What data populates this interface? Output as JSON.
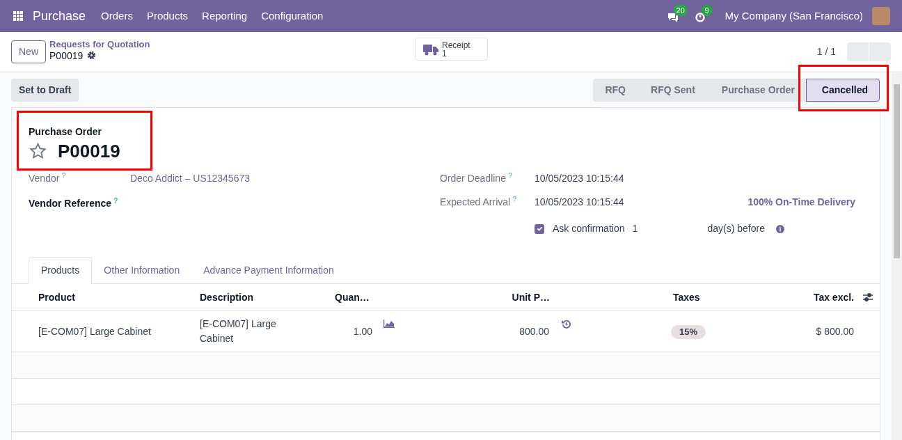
{
  "navbar": {
    "app": "Purchase",
    "menu": [
      "Orders",
      "Products",
      "Reporting",
      "Configuration"
    ],
    "messages_count": "20",
    "activities_count": "9",
    "company": "My Company (San Francisco)"
  },
  "control_panel": {
    "new_button": "New",
    "breadcrumb": "Requests for Quotation",
    "record": "P00019",
    "smart_button": {
      "label": "Receipt",
      "value": "1"
    },
    "pager": "1 / 1"
  },
  "action_button": "Set to Draft",
  "status_bar": [
    {
      "label": "RFQ",
      "selected": false
    },
    {
      "label": "RFQ Sent",
      "selected": false
    },
    {
      "label": "Purchase Order",
      "selected": false
    },
    {
      "label": "Cancelled",
      "selected": true
    }
  ],
  "form": {
    "title_label": "Purchase Order",
    "starred": false,
    "name": "P00019",
    "left_fields": [
      {
        "label": "Vendor",
        "help": "?",
        "value": "Deco Addict – US12345673",
        "bold": false
      },
      {
        "label": "Vendor Reference",
        "help": "?",
        "bold": true
      }
    ],
    "right_fields": [
      {
        "label": "Order Deadline",
        "help": "?",
        "value": "10/05/2023 10:15:44"
      },
      {
        "label": "Expected Arrival",
        "help": "?",
        "value": "10/05/2023 10:15:44",
        "extra": "100% On-Time Delivery"
      }
    ],
    "ask_confirmation": {
      "checked": true,
      "label": "Ask confirmation",
      "days": "1",
      "suffix": "day(s) before"
    }
  },
  "tabs": [
    {
      "label": "Products",
      "selected": true
    },
    {
      "label": "Other Information",
      "selected": false
    },
    {
      "label": "Advance Payment Information",
      "selected": false
    }
  ],
  "table": {
    "columns": [
      "Product",
      "Description",
      "Quan…",
      "Unit P…",
      "Taxes",
      "Tax excl."
    ],
    "rows": [
      {
        "product": "[E-COM07] Large Cabinet",
        "description": "[E-COM07] Large Cabinet",
        "quantity": "1.00",
        "unit_price": "800.00",
        "taxes": "15%",
        "subtotal": "$ 800.00"
      }
    ]
  }
}
